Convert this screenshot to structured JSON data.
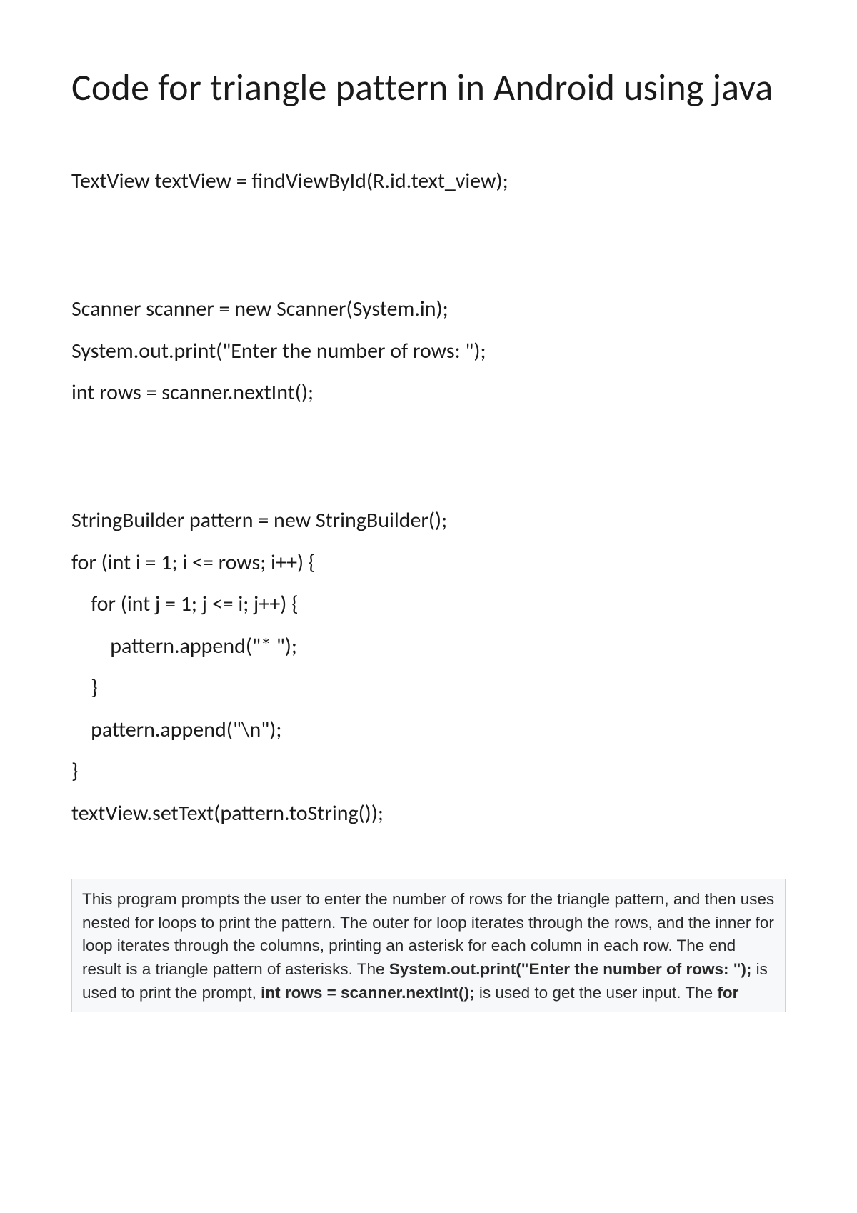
{
  "title": "Code for triangle pattern in Android using java",
  "code": {
    "l1": "TextView textView = findViewById(R.id.text_view);",
    "l2": "Scanner scanner = new Scanner(System.in);",
    "l3": "System.out.print(\"Enter the number of rows: \");",
    "l4": "int rows = scanner.nextInt();",
    "l5": "StringBuilder pattern = new StringBuilder();",
    "l6": "for (int i = 1; i <= rows; i++) {",
    "l7": "    for (int j = 1; j <= i; j++) {",
    "l8": "        pattern.append(\"* \");",
    "l9": "    }",
    "l10": "    pattern.append(\"\\n\");",
    "l11": "}",
    "l12": "textView.setText(pattern.toString());"
  },
  "explain": {
    "p1a": "This program prompts the user to enter the number of rows for the triangle pattern, and then uses nested for loops to print the pattern. The outer for loop iterates through the rows, and the inner for loop iterates through the columns, printing an asterisk for each column in each row. The end result is a triangle pattern of asterisks. The ",
    "code1": "System.out.print(\"Enter the number of rows: \");",
    "p1b": " is used to print the prompt, ",
    "code2": "int rows = scanner.nextInt();",
    "p1c": " is used to get the user input. The ",
    "code3": "for"
  }
}
